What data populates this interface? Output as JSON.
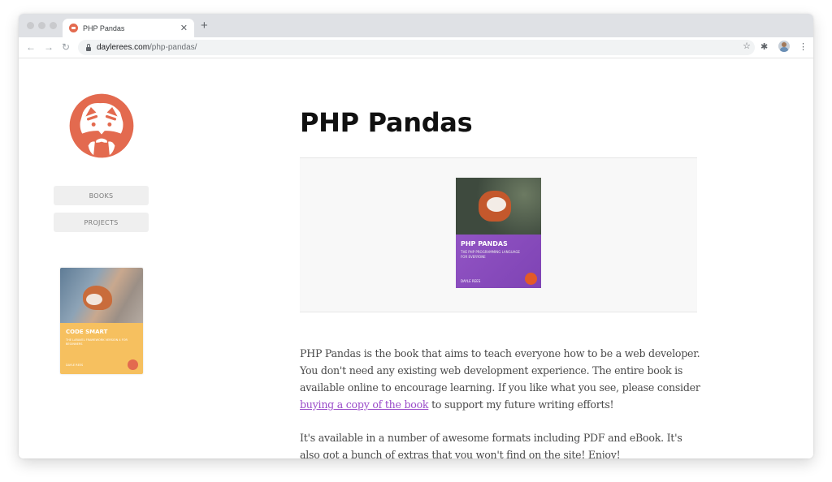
{
  "browser": {
    "tab": {
      "title": "PHP Pandas",
      "favicon": "red-panda-favicon",
      "close_glyph": "✕"
    },
    "new_tab_glyph": "+",
    "nav": {
      "back_glyph": "←",
      "forward_glyph": "→",
      "reload_glyph": "↻"
    },
    "address": {
      "domain": "dayleree s.com",
      "domain_text": "daylerees.com",
      "path": "/php-pandas/"
    },
    "icons": {
      "star_glyph": "☆",
      "extensions_glyph": "✱",
      "menu_glyph": "⋮"
    }
  },
  "sidebar": {
    "logo": "red-panda-logo",
    "logo_color": "#e36a4f",
    "nav": [
      {
        "label": "BOOKS"
      },
      {
        "label": "PROJECTS"
      }
    ],
    "featured_book": {
      "title": "CODE SMART",
      "subtitle": "THE LARAVEL FRAMEWORK VERSION 4 FOR BEGINNERS",
      "author": "DAYLE REES",
      "color": "#f6c05f"
    }
  },
  "main": {
    "title": "PHP Pandas",
    "cover": {
      "title": "PHP PANDAS",
      "subtitle": "THE PHP PROGRAMMING LANGUAGE FOR EVERYONE",
      "author": "DAYLE REES",
      "color": "#8a4dc0"
    },
    "paragraph1": {
      "before_link": "PHP Pandas is the book that aims to teach everyone how to be a web developer. You don't need any existing web development experience. The entire book is available online to encourage learning. If you like what you see, please consider ",
      "link": "buying a copy of the book",
      "after_link": " to support my future writing efforts!"
    },
    "paragraph2": "It's available in a number of awesome formats including PDF and eBook. It's also got a bunch of extras that you won't find on the site! Enjoy!",
    "link_color": "#9b4dca"
  }
}
